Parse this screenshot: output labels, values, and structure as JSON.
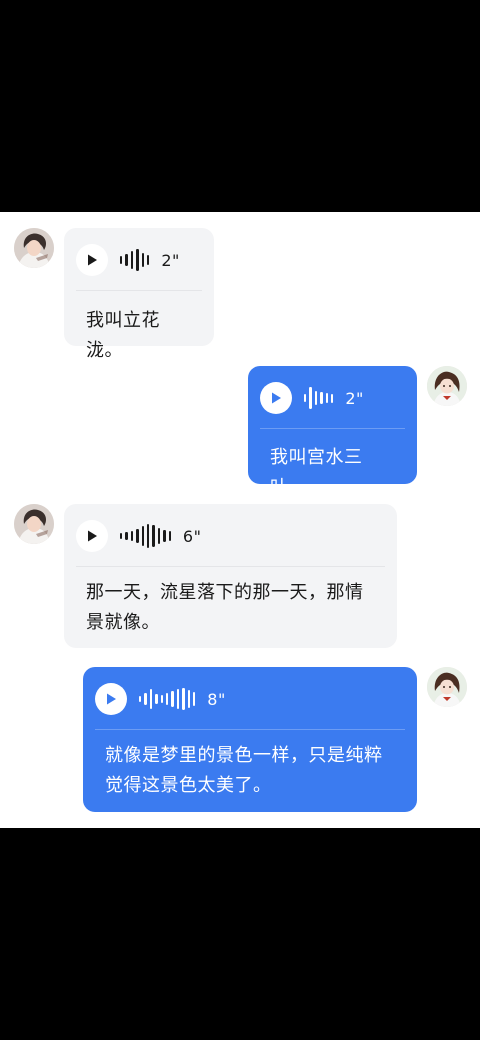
{
  "messages": [
    {
      "side": "received",
      "duration": "2\"",
      "text": "我叫立花泷。"
    },
    {
      "side": "sent",
      "duration": "2\"",
      "text": "我叫宫水三叶。"
    },
    {
      "side": "received",
      "duration": "6\"",
      "text": "那一天，流星落下的那一天，那情景就像。"
    },
    {
      "side": "sent",
      "duration": "8\"",
      "text": "就像是梦里的景色一样，只是纯粹觉得这景色太美了。"
    }
  ],
  "colors": {
    "sent_bubble": "#3b7bf0",
    "received_bubble": "#f3f4f6",
    "background": "#ffffff",
    "letterbox": "#000000"
  },
  "icons": {
    "play": "play-icon",
    "waveform": "waveform-icon",
    "avatar_left": "avatar-taki",
    "avatar_right": "avatar-mitsuha"
  }
}
